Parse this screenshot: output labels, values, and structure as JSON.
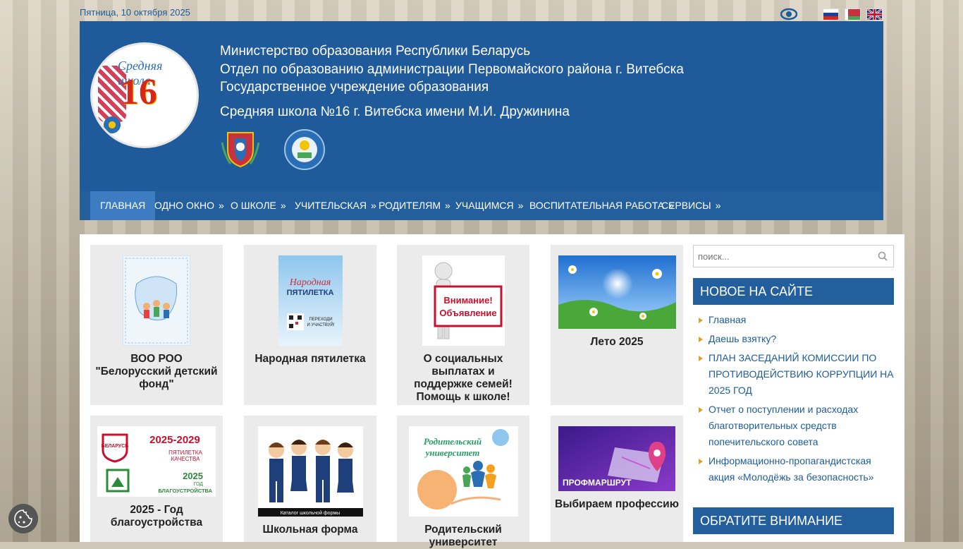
{
  "topbar": {
    "date": "Пятница, 10 октября 2025",
    "accessibility_icon": "eye-icon",
    "languages": [
      "ru",
      "by",
      "en"
    ]
  },
  "header": {
    "line1": "Министерство образования Республики Беларусь",
    "line2": "Отдел по образованию администрации Первомайского района г. Витебска",
    "line3": "Государственное учреждение образования",
    "school": "Средняя школа №16 г. Витебска имени М.И. Дружинина",
    "logo_text": "16",
    "logo_sub": "Средняя школа"
  },
  "nav": [
    {
      "label": "Главная",
      "arrow": ""
    },
    {
      "label": "Одно окно",
      "arrow": "»"
    },
    {
      "label": "О школе",
      "arrow": "»"
    },
    {
      "label": "Учительская",
      "arrow": "»"
    },
    {
      "label": "Родителям",
      "arrow": "»"
    },
    {
      "label": "Учащимся",
      "arrow": "»"
    },
    {
      "label": "Воспитательная работа",
      "arrow": "»"
    },
    {
      "label": "Сервисы",
      "arrow": "»"
    }
  ],
  "cards": [
    {
      "title": "ВОО РОО \"Белорусский детский фонд\""
    },
    {
      "title": "Народная пятилетка",
      "img_text": "Народная ПЯТИЛЕТКА"
    },
    {
      "title": "О социальных выплатах и поддержке семей! Помощь к школе!",
      "img_text": "Внимание! Объявление"
    },
    {
      "title": "Лето 2025"
    },
    {
      "title": "2025 - Год благоустройства",
      "img_text1": "2025-2029",
      "img_text2": "ПЯТИЛЕТКА КАЧЕСТВА",
      "img_text3": "2025 ГОД БЛАГОУСТРОЙСТВА"
    },
    {
      "title": "Школьная форма",
      "img_text": "Каталог школьной формы"
    },
    {
      "title": "Родительский университет",
      "img_text": "Родительский университет"
    },
    {
      "title": "Выбираем профессию",
      "img_text": "ПРОФМАРШРУТ"
    }
  ],
  "sidebar": {
    "search_placeholder": "поиск...",
    "new_title": "Новое на сайте",
    "news": [
      "Главная",
      "Даешь взятку?",
      "ПЛАН ЗАСЕДАНИЙ КОМИССИИ ПО ПРОТИВОДЕЙСТВИЮ КОРРУПЦИИ НА 2025 ГОД",
      "Отчет о поступлении и расходах благотворительных средств попечительского совета",
      "Информационно-пропагандистская акция «Молодёжь за безопасность»"
    ],
    "attention_title": "Обратите внимание"
  },
  "colors": {
    "primary": "#1f5a9a",
    "nav": "#245f9d",
    "nav_active": "#3d7cc0",
    "link": "#1d5c9a"
  }
}
